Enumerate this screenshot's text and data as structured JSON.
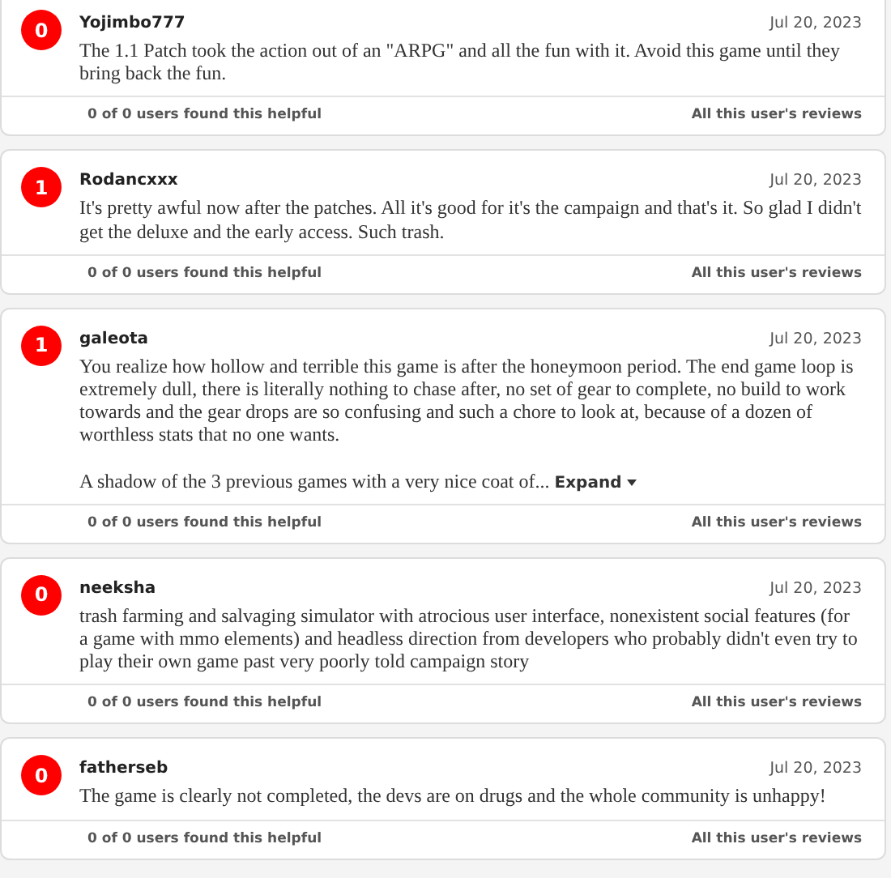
{
  "reviews": [
    {
      "score": "0",
      "user": "Yojimbo777",
      "date": "Jul 20, 2023",
      "text": "The 1.1 Patch took the action out of an \"ARPG\" and all the fun with it. Avoid this game until they bring back the fun.",
      "helpful": "0 of 0 users found this helpful",
      "all_reviews": "All this user's reviews"
    },
    {
      "score": "1",
      "user": "Rodancxxx",
      "date": "Jul 20, 2023",
      "text": "It's pretty awful now after the patches. All it's good for it's the campaign and that's it. So glad I didn't get the deluxe and the early access. Such trash.",
      "helpful": "0 of 0 users found this helpful",
      "all_reviews": "All this user's reviews"
    },
    {
      "score": "1",
      "user": "galeota",
      "date": "Jul 20, 2023",
      "text": "You realize how hollow and terrible this game is after the honeymoon period. The end game loop is extremely dull, there is literally nothing to chase after, no set of gear to complete, no build to work towards and the gear drops are so confusing and such a chore to look at, because of a dozen of worthless stats that no one wants.",
      "more": "A shadow of the 3 previous games with a very nice coat of...",
      "expand": "Expand",
      "helpful": "0 of 0 users found this helpful",
      "all_reviews": "All this user's reviews"
    },
    {
      "score": "0",
      "user": "neeksha",
      "date": "Jul 20, 2023",
      "text": "trash farming and salvaging simulator with atrocious user interface, nonexistent social features (for a game with mmo elements) and headless direction from developers who probably didn't even try to play their own game past very poorly told campaign story",
      "helpful": "0 of 0 users found this helpful",
      "all_reviews": "All this user's reviews"
    },
    {
      "score": "0",
      "user": "fatherseb",
      "date": "Jul 20, 2023",
      "text": "The game is clearly not completed, the devs are on drugs and the whole community is unhappy!",
      "helpful": "0 of 0 users found this helpful",
      "all_reviews": "All this user's reviews"
    }
  ]
}
